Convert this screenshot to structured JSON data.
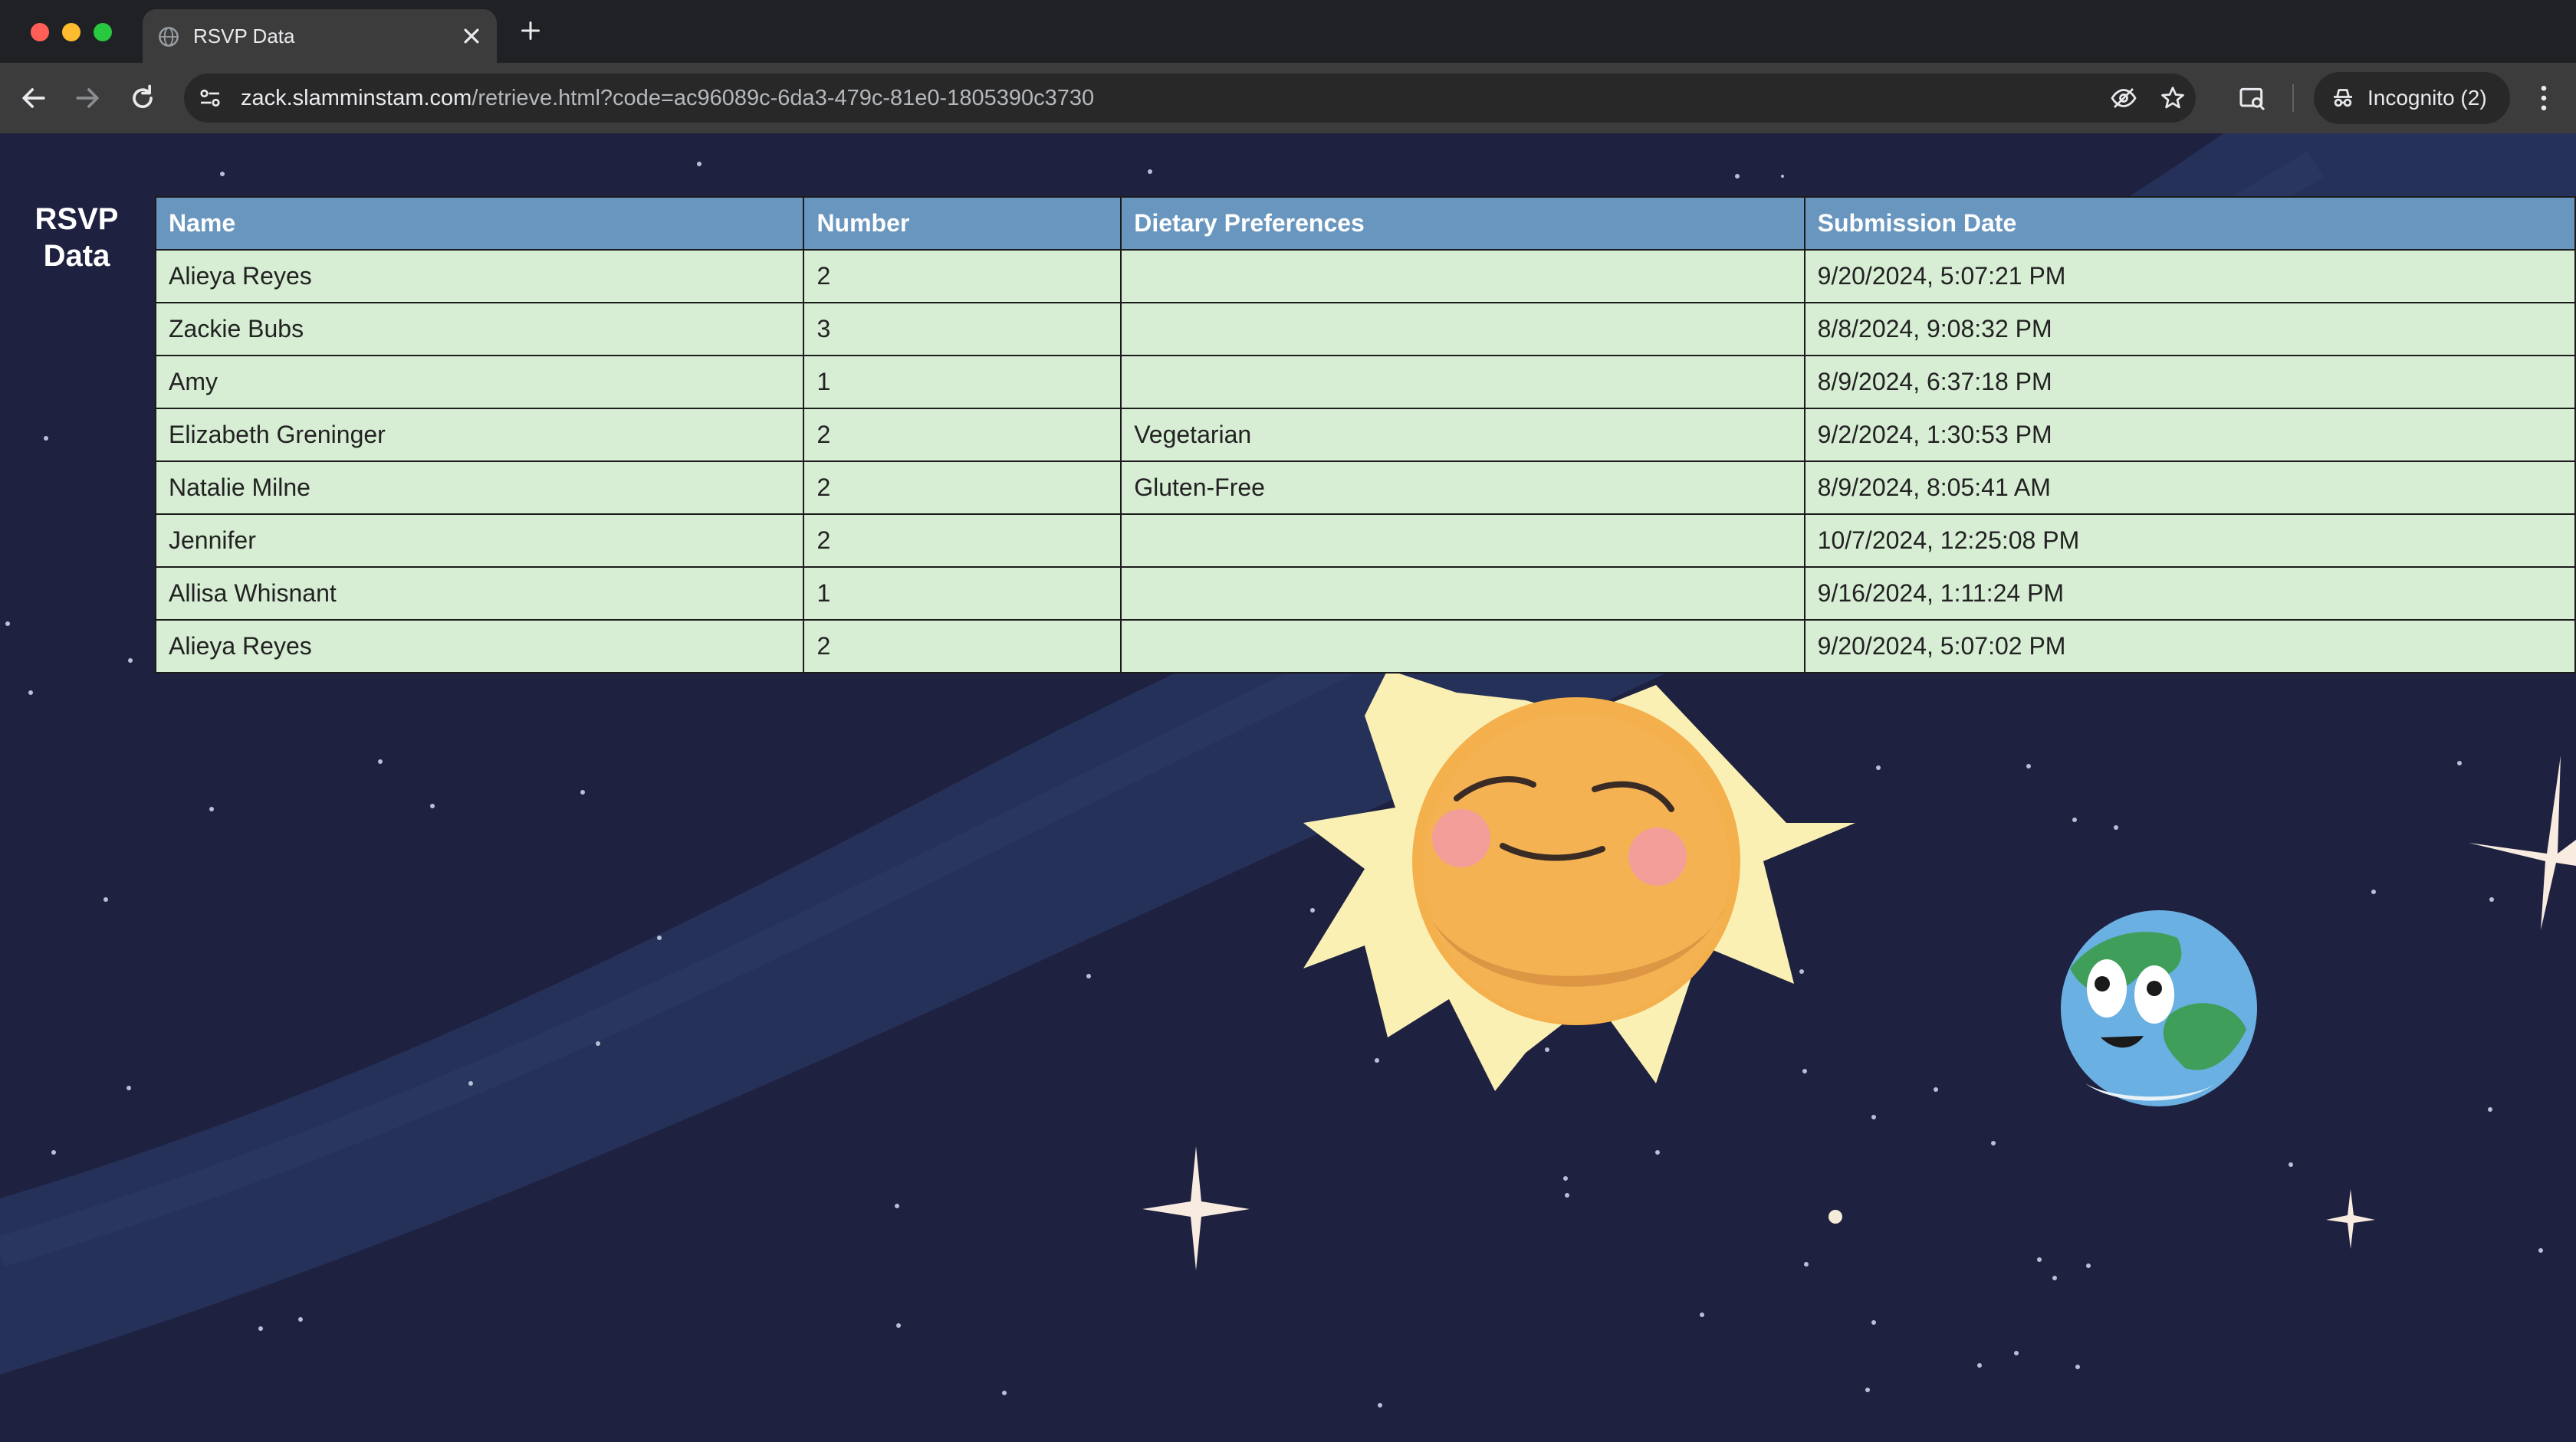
{
  "browser": {
    "tab_title": "RSVP Data",
    "url_host": "zack.slamminstam.com",
    "url_path": "/retrieve.html?code=ac96089c-6da3-479c-81e0-1805390c3730",
    "incognito_label": "Incognito (2)"
  },
  "page": {
    "title_line1": "RSVP",
    "title_line2": "Data"
  },
  "table": {
    "headers": [
      "Name",
      "Number",
      "Dietary Preferences",
      "Submission Date"
    ],
    "rows": [
      [
        "Alieya Reyes",
        "2",
        "",
        "9/20/2024, 5:07:21 PM"
      ],
      [
        "Zackie Bubs",
        "3",
        "",
        "8/8/2024, 9:08:32 PM"
      ],
      [
        "Amy",
        "1",
        "",
        "8/9/2024, 6:37:18 PM"
      ],
      [
        "Elizabeth Greninger",
        "2",
        "Vegetarian",
        "9/2/2024, 1:30:53 PM"
      ],
      [
        "Natalie Milne",
        "2",
        "Gluten-Free",
        "8/9/2024, 8:05:41 AM"
      ],
      [
        "Jennifer",
        "2",
        "",
        "10/7/2024, 12:25:08 PM"
      ],
      [
        "Allisa Whisnant",
        "1",
        "",
        "9/16/2024, 1:11:24 PM"
      ],
      [
        "Alieya Reyes",
        "2",
        "",
        "9/20/2024, 5:07:02 PM"
      ]
    ]
  },
  "icons": {
    "tab_favicon": "globe-icon",
    "close": "close-icon",
    "new_tab": "plus-icon",
    "back": "back-arrow-icon",
    "forward": "forward-arrow-icon",
    "reload": "reload-icon",
    "site_info": "tune-icon",
    "eye_off": "eye-off-icon",
    "bookmark": "star-icon",
    "lens": "lens-icon",
    "incognito": "incognito-icon",
    "menu": "kebab-menu-icon"
  },
  "colors": {
    "page_background": "#1f2140",
    "table_header": "#6996bf",
    "table_cell": "#d7eed4",
    "sun": "#f3b04d",
    "sun_rays": "#fbf0b4"
  }
}
